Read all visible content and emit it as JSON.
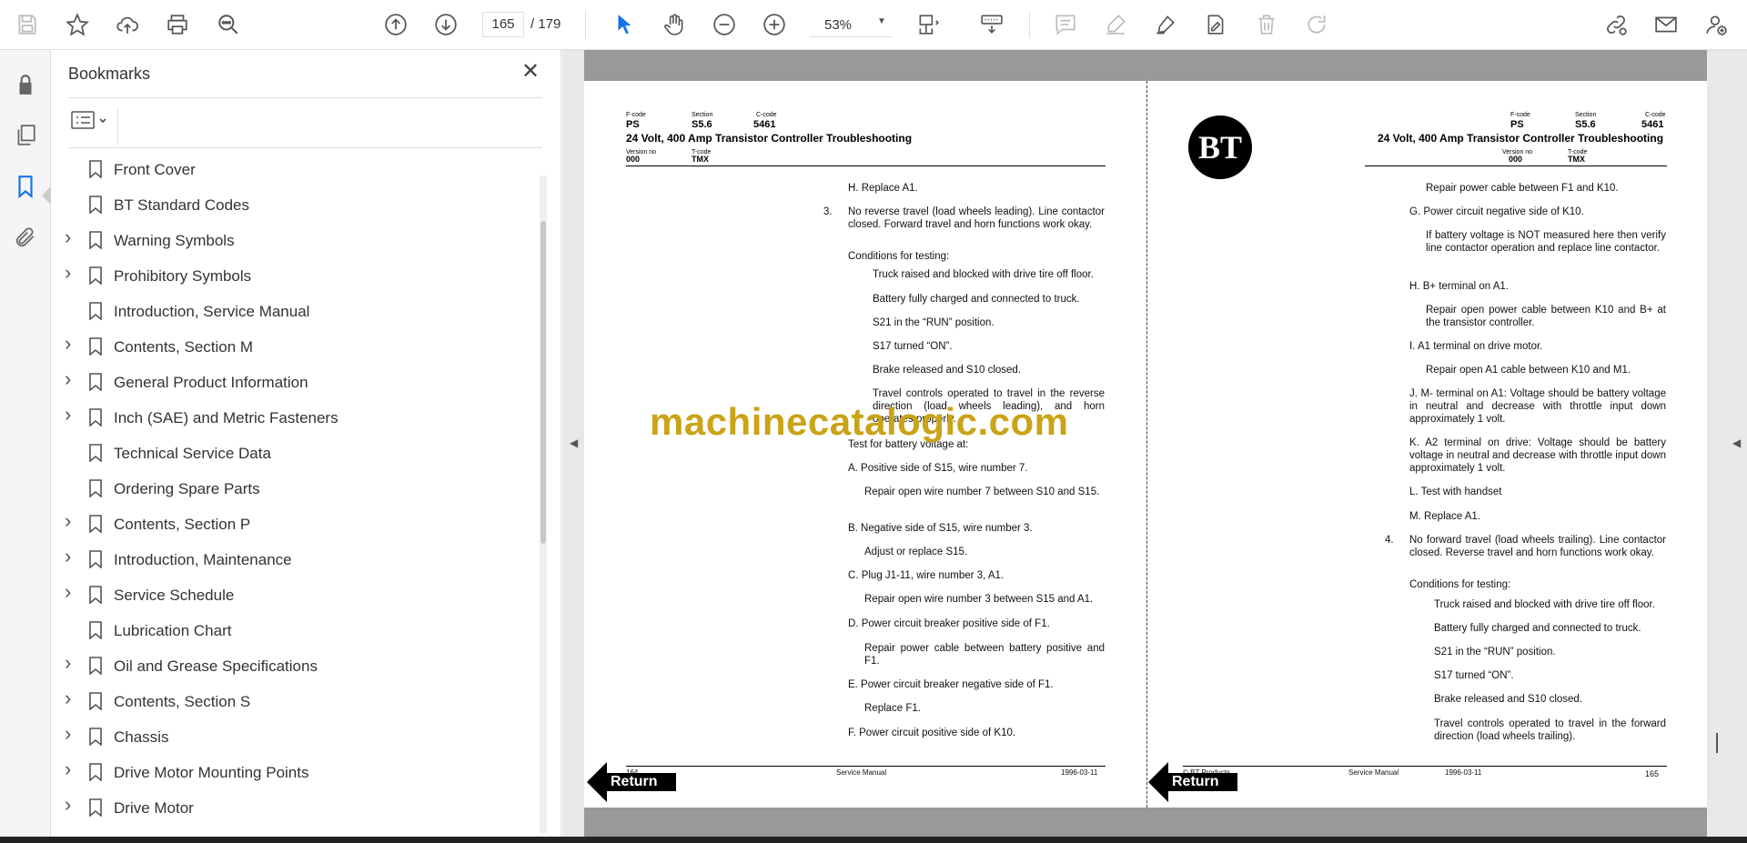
{
  "toolbar": {
    "page_current": "165",
    "page_total": "/  179",
    "zoom": "53%"
  },
  "panel": {
    "title": "Bookmarks",
    "close": "✕"
  },
  "bookmarks": [
    {
      "label": "Front Cover",
      "expandable": false
    },
    {
      "label": "BT Standard Codes",
      "expandable": false
    },
    {
      "label": "Warning Symbols",
      "expandable": true
    },
    {
      "label": "Prohibitory Symbols",
      "expandable": true
    },
    {
      "label": "Introduction, Service Manual",
      "expandable": false
    },
    {
      "label": "Contents, Section M",
      "expandable": true
    },
    {
      "label": "General Product Information",
      "expandable": true
    },
    {
      "label": "Inch (SAE) and Metric Fasteners",
      "expandable": true
    },
    {
      "label": "Technical Service Data",
      "expandable": false
    },
    {
      "label": "Ordering Spare Parts",
      "expandable": false
    },
    {
      "label": "Contents, Section P",
      "expandable": true
    },
    {
      "label": "Introduction, Maintenance",
      "expandable": true
    },
    {
      "label": "Service Schedule",
      "expandable": true
    },
    {
      "label": "Lubrication Chart",
      "expandable": false
    },
    {
      "label": "Oil and Grease Specifications",
      "expandable": true
    },
    {
      "label": "Contents, Section S",
      "expandable": true
    },
    {
      "label": "Chassis",
      "expandable": true
    },
    {
      "label": "Drive Motor Mounting Points",
      "expandable": true
    },
    {
      "label": "Drive Motor",
      "expandable": true
    }
  ],
  "header": {
    "fcode_label": "F-code",
    "section_label": "Section",
    "ccode_label": "C-code",
    "fcode": "PS",
    "section": "S5.6",
    "ccode": "5461",
    "title": "24 Volt, 400 Amp Transistor Controller Troubleshooting",
    "version_label": "Version no",
    "tcode_label": "T-code",
    "version": "000",
    "tcode": "TMX"
  },
  "left_page": {
    "lines": [
      "H.  Replace A1.",
      "3.",
      "No reverse travel (load wheels leading). Line contactor closed. Forward travel and horn functions work okay.",
      "Conditions for testing:",
      "Truck raised and blocked with drive tire off floor.",
      "Battery fully charged and connected to truck.",
      "S21 in the “RUN” position.",
      "S17 turned “ON”.",
      "Brake released and S10 closed.",
      "Travel controls operated to travel in the reverse direction (load wheels leading), and horn operates properly.",
      "Test for battery voltage at:",
      "A.  Positive side of S15, wire number 7.",
      "Repair open wire number 7 between S10 and S15.",
      "B.  Negative side of S15, wire number 3.",
      "Adjust or replace S15.",
      "C.  Plug J1-11, wire number 3, A1.",
      "Repair open wire number 3 between S15 and A1.",
      "D.  Power circuit breaker positive side of F1.",
      "Repair power cable between battery positive and F1.",
      "E.  Power circuit breaker negative side of F1.",
      "Replace F1.",
      "F.  Power circuit positive side of K10."
    ],
    "footer_page": "164",
    "footer_center": "Service Manual",
    "footer_date": "1996-03-11"
  },
  "right_page": {
    "lines": [
      "Repair power cable between F1 and K10.",
      "G.  Power circuit negative side of K10.",
      "If battery voltage is NOT measured here then verify line contactor operation and replace line contactor.",
      "H.  B+ terminal on A1.",
      "Repair open power cable between K10 and B+ at the transistor controller.",
      "I.   A1 terminal on drive motor.",
      "Repair open A1 cable between K10 and M1.",
      "J.  M- terminal on A1: Voltage should be battery voltage in neutral and decrease with throttle input down approximately 1 volt.",
      "K.  A2 terminal on drive: Voltage should be battery voltage in neutral and decrease with throttle input down approximately 1 volt.",
      "L.  Test with handset",
      "M.  Replace A1.",
      "4.",
      "No forward travel (load wheels trailing). Line contactor closed. Reverse travel and horn functions work okay.",
      "Conditions for testing:",
      "Truck raised and blocked with drive tire off floor.",
      "Battery fully charged and connected to truck.",
      "S21 in the “RUN” position.",
      "S17 turned “ON”.",
      "Brake released and S10 closed.",
      "Travel controls operated to travel in the forward direction (load wheels trailing)."
    ],
    "footer_left": "© BT Products",
    "footer_center": "Service Manual",
    "footer_date": "1996-03-11",
    "footer_page": "165"
  },
  "return_label": "Return",
  "watermark": "machinecatalogic.com",
  "logo_text": "BT"
}
